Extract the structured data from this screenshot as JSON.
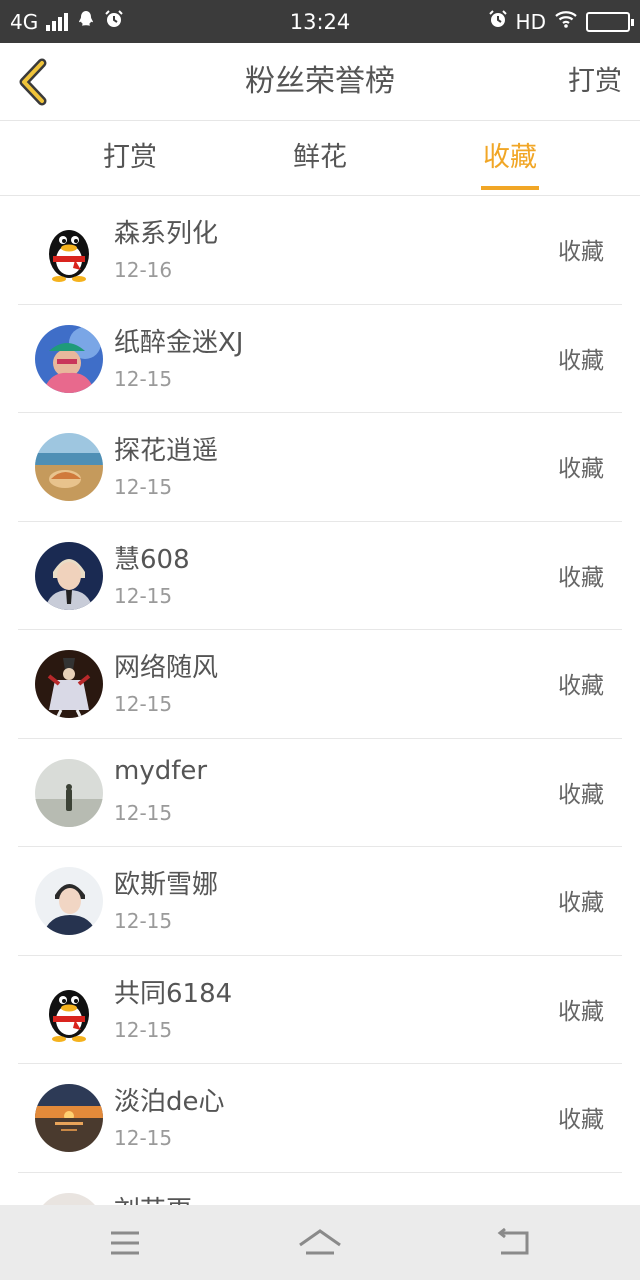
{
  "status_bar": {
    "network": "4G",
    "time": "13:24",
    "hd": "HD"
  },
  "header": {
    "title": "粉丝荣誉榜",
    "action": "打赏"
  },
  "tabs": [
    {
      "label": "打赏",
      "active": false
    },
    {
      "label": "鲜花",
      "active": false
    },
    {
      "label": "收藏",
      "active": true
    }
  ],
  "fans": [
    {
      "name": "森系列化",
      "date": "12-16",
      "action": "收藏",
      "avatar": "qq-penguin-avatar"
    },
    {
      "name": "纸醉金迷XJ",
      "date": "12-15",
      "action": "收藏",
      "avatar": "person-cap-avatar"
    },
    {
      "name": "探花逍遥",
      "date": "12-15",
      "action": "收藏",
      "avatar": "beach-shell-avatar"
    },
    {
      "name": "慧608",
      "date": "12-15",
      "action": "收藏",
      "avatar": "person-suit-avatar"
    },
    {
      "name": "网络随风",
      "date": "12-15",
      "action": "收藏",
      "avatar": "anime-character-avatar"
    },
    {
      "name": "mydfer",
      "date": "12-15",
      "action": "收藏",
      "avatar": "foggy-figure-avatar"
    },
    {
      "name": "欧斯雪娜",
      "date": "12-15",
      "action": "收藏",
      "avatar": "young-man-avatar"
    },
    {
      "name": "共同6184",
      "date": "12-15",
      "action": "收藏",
      "avatar": "qq-penguin-avatar"
    },
    {
      "name": "淡泊de心",
      "date": "12-15",
      "action": "收藏",
      "avatar": "sunset-sea-avatar"
    },
    {
      "name": "刘艺更",
      "date": "",
      "action": "",
      "avatar": "woman-avatar"
    }
  ],
  "colors": {
    "accent": "#f1a626",
    "text": "#555555",
    "status_bar": "#3b3b3b",
    "nav_bar": "#ebebeb"
  }
}
